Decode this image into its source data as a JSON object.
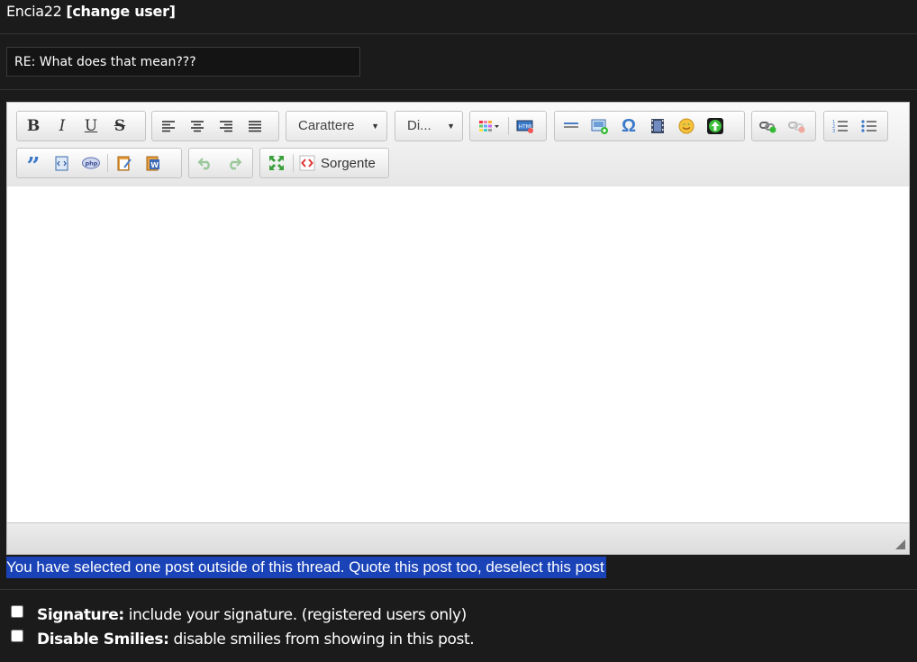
{
  "header": {
    "username": "Encia22",
    "change_user": "[change user]"
  },
  "subject": {
    "value": "RE: What does that mean???"
  },
  "toolbar": {
    "bold": "B",
    "italic": "I",
    "underline": "U",
    "strike": "S",
    "font_combo": "Carattere",
    "size_combo": "Di...",
    "special_char": "Ω",
    "source_label": "Sorgente"
  },
  "notice": {
    "text": "You have selected one post outside of this thread. Quote this post too, deselect this post"
  },
  "options": {
    "signature_label": "Signature:",
    "signature_desc": "include your signature. (registered users only)",
    "smilies_label": "Disable Smilies:",
    "smilies_desc": "disable smilies from showing in this post."
  },
  "colors": {
    "background": "#1b1b1b",
    "notice_bg": "#1a43b8"
  }
}
